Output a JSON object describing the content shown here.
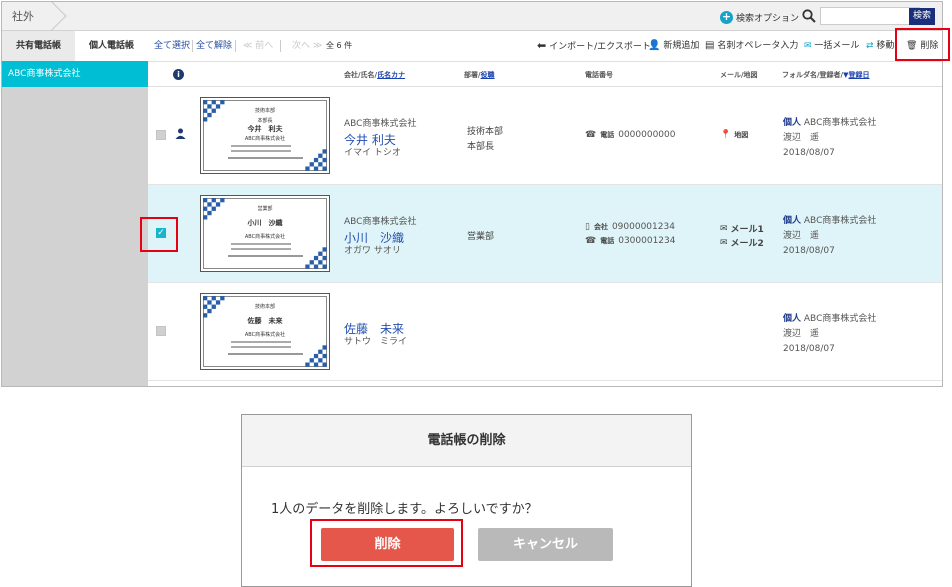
{
  "breadcrumb": {
    "label": "社外"
  },
  "search": {
    "option_label": "検索オプション",
    "placeholder": "",
    "button_label": "検索"
  },
  "tabs": {
    "shared": "共有電話帳",
    "personal": "個人電話帳"
  },
  "sidebar": {
    "items": [
      {
        "label": "ABC商事株式会社"
      }
    ]
  },
  "toolbar": {
    "select_all": "全て選択",
    "deselect_all": "全て解除",
    "prev": "≪ 前へ",
    "next": "次へ ≫",
    "count": "全 6 件",
    "import_export": "インポート/エクスポート",
    "add_new": "新規追加",
    "card_operator": "名刺オペレータ入力",
    "bulk_mail": "一括メール",
    "move": "移動",
    "delete": "削除"
  },
  "header": {
    "company_name_prefix": "会社/氏名/",
    "name_kana": "氏名カナ",
    "dept_prefix": "部署/",
    "title": "役職",
    "phone": "電話番号",
    "mail_map": "メール/地図",
    "folder_prefix": "フォルダ名/登録者/",
    "reg_date": "登録日"
  },
  "rows": [
    {
      "company": "ABC商事株式会社",
      "name": "今井 利夫",
      "kana": "イマイ トシオ",
      "dept": "技術本部",
      "title": "本部長",
      "phones": [
        {
          "label": "電話",
          "number": "0000000000"
        }
      ],
      "mails": [],
      "map": "地図",
      "folder_type": "個人",
      "folder_company": "ABC商事株式会社",
      "registrant": "渡辺　遥",
      "date": "2018/08/07",
      "checked": false,
      "card": {
        "dept": "技術本部",
        "title": "本部長",
        "name": "今井　利夫",
        "company": "ABC商事株式会社"
      }
    },
    {
      "company": "ABC商事株式会社",
      "name": "小川　沙織",
      "kana": "オガワ サオリ",
      "dept": "営業部",
      "title": "",
      "phones": [
        {
          "label": "会社",
          "number": "09000001234"
        },
        {
          "label": "電話",
          "number": "0300001234"
        }
      ],
      "mails": [
        "メール1",
        "メール2"
      ],
      "map": "",
      "folder_type": "個人",
      "folder_company": "ABC商事株式会社",
      "registrant": "渡辺　遥",
      "date": "2018/08/07",
      "checked": true,
      "card": {
        "dept": "営業部",
        "title": "",
        "name": "小川　沙織",
        "company": "ABC商事株式会社"
      }
    },
    {
      "company": "",
      "name": "佐藤　未来",
      "kana": "サトウ　ミライ",
      "dept": "",
      "title": "",
      "phones": [],
      "mails": [],
      "map": "",
      "folder_type": "個人",
      "folder_company": "ABC商事株式会社",
      "registrant": "渡辺　遥",
      "date": "2018/08/07",
      "checked": false,
      "card": {
        "dept": "技術本部",
        "title": "",
        "name": "佐藤　未来",
        "company": "ABC商事株式会社"
      }
    }
  ],
  "dialog": {
    "title": "電話帳の削除",
    "message": "1人のデータを削除します。よろしいですか？",
    "delete_label": "削除",
    "cancel_label": "キャンセル"
  },
  "colors": {
    "accent": "#00bfd4",
    "link": "#2a4ea0",
    "highlight": "#e60012",
    "delete_button": "#e4574a",
    "cancel_button": "#b9b9b9",
    "search_button": "#1a2f7a"
  }
}
